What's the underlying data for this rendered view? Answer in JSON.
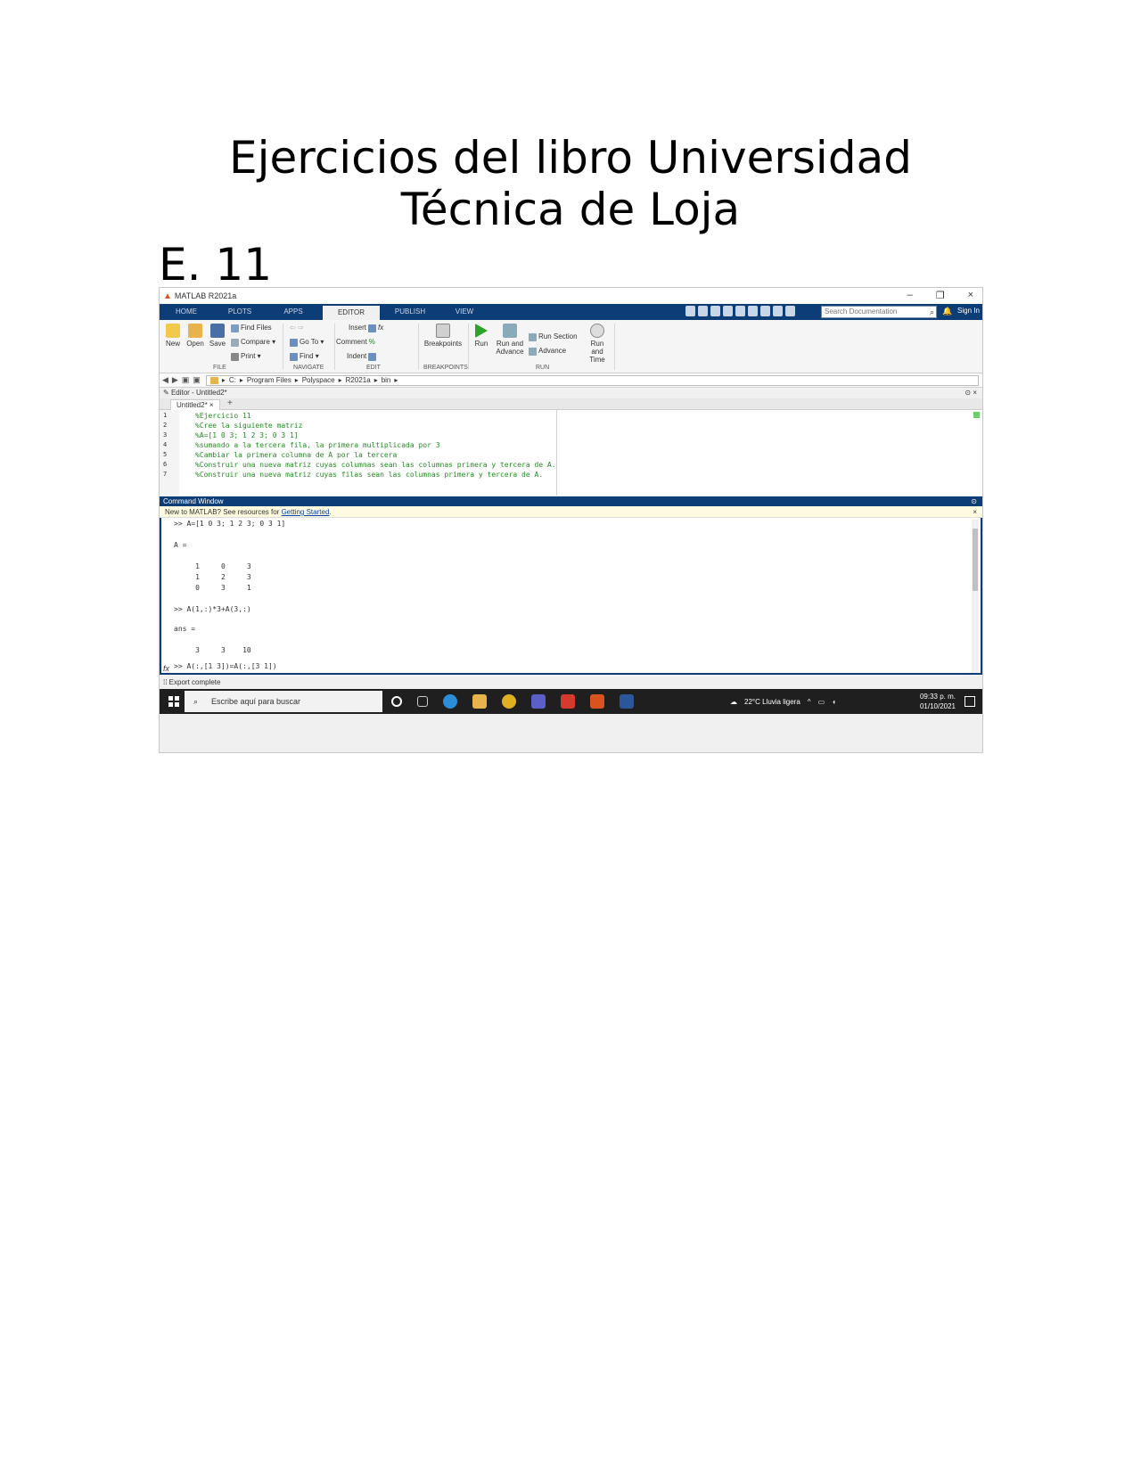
{
  "document": {
    "title": "Ejercicios del libro Universidad Técnica de Loja",
    "subtitle": "E. 11"
  },
  "window": {
    "title": "MATLAB R2021a",
    "controls": [
      "–",
      "❐",
      "×"
    ]
  },
  "tabs": [
    "HOME",
    "PLOTS",
    "APPS",
    "EDITOR",
    "PUBLISH",
    "VIEW"
  ],
  "active_tab": "EDITOR",
  "search": {
    "placeholder": "Search Documentation"
  },
  "sign_in": "Sign In",
  "ribbon": {
    "file": {
      "new": "New",
      "open": "Open",
      "save": "Save",
      "find_files": "Find Files",
      "compare": "Compare ▾",
      "print": "Print ▾",
      "label": "FILE"
    },
    "navigate": {
      "go_to": "Go To ▾",
      "find": "Find ▾",
      "label": "NAVIGATE"
    },
    "edit": {
      "insert": "Insert",
      "comment": "Comment",
      "indent": "Indent",
      "label": "EDIT"
    },
    "breakpoints": {
      "breakpoints": "Breakpoints",
      "label": "BREAKPOINTS"
    },
    "run": {
      "run": "Run",
      "run_and_advance": "Run and Advance",
      "run_section": "Run Section",
      "advance": "Advance",
      "run_and_time": "Run and Time",
      "label": "RUN"
    }
  },
  "path": [
    "C:",
    "Program Files",
    "Polyspace",
    "R2021a",
    "bin"
  ],
  "editor": {
    "header": "Editor - Untitled2*",
    "tab": "Untitled2*",
    "lines": [
      "%Ejercicio 11",
      "%Cree la siguiente matriz",
      "%A=[1 0 3; 1 2 3; 0 3 1]",
      "%sumando a la tercera fila, la primera multiplicada por 3",
      "%Cambiar la primera columna de A por la tercera",
      "%Construir una nueva matriz cuyas columnas sean las columnas primera y tercera de A.",
      "%Construir una nueva matriz cuyas filas sean las columnas primera y tercera de A."
    ]
  },
  "command_window": {
    "header": "Command Window",
    "info_prefix": "New to MATLAB? See resources for ",
    "info_link": "Getting Started",
    "info_suffix": ".",
    "lines": [
      ">> A=[1 0 3; 1 2 3; 0 3 1]",
      "",
      "A =",
      "",
      "     1     0     3",
      "     1     2     3",
      "     0     3     1",
      "",
      ">> A(1,:)*3+A(3,:)",
      "",
      "ans =",
      "",
      "     3     3    10",
      "",
      ">> A(:,[1 3])=A(:,[3 1])"
    ],
    "prompt_symbol": "fx"
  },
  "status": "Export complete",
  "taskbar": {
    "search_placeholder": "Escribe aquí para buscar",
    "weather": "22°C Lluvia ligera",
    "time": "09:33 p. m.",
    "date": "01/10/2021"
  },
  "colors": {
    "tab_bar": "#0d3d77",
    "comment_green": "#228b22",
    "taskbar": "#1f1f1f"
  }
}
